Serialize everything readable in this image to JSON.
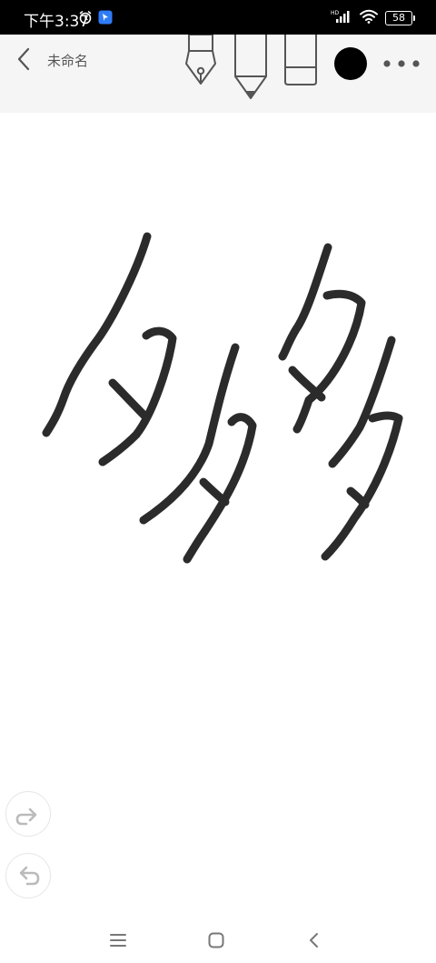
{
  "status_bar": {
    "time": "下午3:37",
    "network_badge": "HD",
    "battery_level": "58",
    "icons": [
      "alarm-icon",
      "app-notification-icon",
      "signal-icon",
      "wifi-icon",
      "battery-icon"
    ]
  },
  "toolbar": {
    "back_icon": "chevron-left-icon",
    "document_title": "未命名",
    "tools": [
      "fountain-pen-tool",
      "marker-pen-tool",
      "eraser-tool"
    ],
    "color_swatch": "#000000",
    "more_icon": "more-horizontal-icon"
  },
  "canvas": {
    "ink_color": "#2b2b2b",
    "strokes_description_count": 3
  },
  "floating_controls": {
    "redo_icon": "redo-icon",
    "undo_icon": "undo-icon"
  },
  "nav_bar": {
    "icons": [
      "menu-icon",
      "home-icon",
      "back-icon"
    ]
  }
}
